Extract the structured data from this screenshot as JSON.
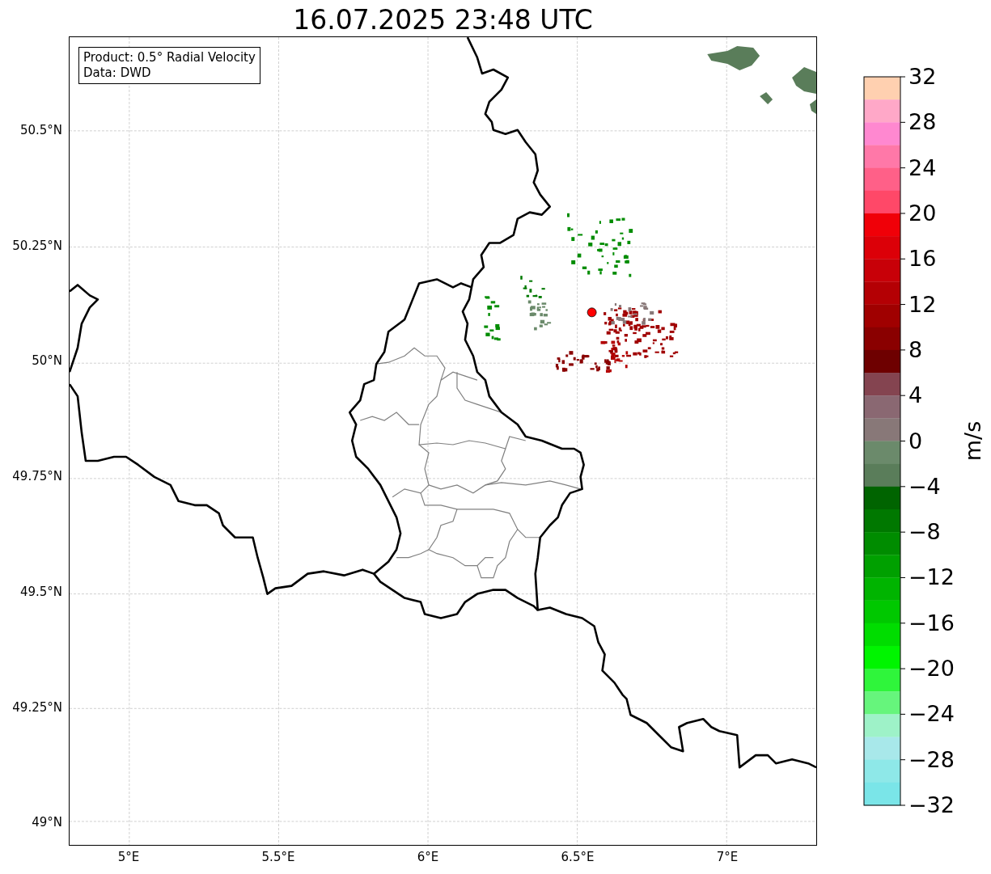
{
  "title": "16.07.2025 23:48 UTC",
  "legend": {
    "lines": [
      "Product: 0.5° Radial Velocity",
      "Data: DWD"
    ]
  },
  "map": {
    "lat_labels": [
      "50.5°N",
      "50.25°N",
      "50°N",
      "49.75°N",
      "49.5°N",
      "49.25°N",
      "49°N"
    ],
    "lon_labels": [
      "5°E",
      "5.5°E",
      "6°E",
      "6.5°E",
      "7°E"
    ]
  },
  "colorbar": {
    "label": "m/s",
    "ticks": [
      "32",
      "28",
      "24",
      "20",
      "16",
      "12",
      "8",
      "4",
      "0",
      "−4",
      "−8",
      "−12",
      "−16",
      "−20",
      "−24",
      "−28",
      "−32"
    ],
    "bands": [
      {
        "color": "#ffd0b0"
      },
      {
        "color": "#ffa8c8"
      },
      {
        "color": "#ff88d0"
      },
      {
        "color": "#ff78a8"
      },
      {
        "color": "#ff6088"
      },
      {
        "color": "#ff4868"
      },
      {
        "color": "#f00008"
      },
      {
        "color": "#dc0008"
      },
      {
        "color": "#c80008"
      },
      {
        "color": "#b40004"
      },
      {
        "color": "#a00000"
      },
      {
        "color": "#8a0000"
      },
      {
        "color": "#6e0000"
      },
      {
        "color": "#844450"
      },
      {
        "color": "#8a6872"
      },
      {
        "color": "#887878"
      },
      {
        "color": "#6b8a6b"
      },
      {
        "color": "#5a7d5a"
      },
      {
        "color": "#006400"
      },
      {
        "color": "#007800"
      },
      {
        "color": "#008c00"
      },
      {
        "color": "#00a000"
      },
      {
        "color": "#00b400"
      },
      {
        "color": "#00c800"
      },
      {
        "color": "#00dd00"
      },
      {
        "color": "#00f500"
      },
      {
        "color": "#2ff53b"
      },
      {
        "color": "#66f57c"
      },
      {
        "color": "#9ef2c8"
      },
      {
        "color": "#a8e8ea"
      },
      {
        "color": "#8ee8e8"
      },
      {
        "color": "#7ae5e8"
      }
    ]
  }
}
